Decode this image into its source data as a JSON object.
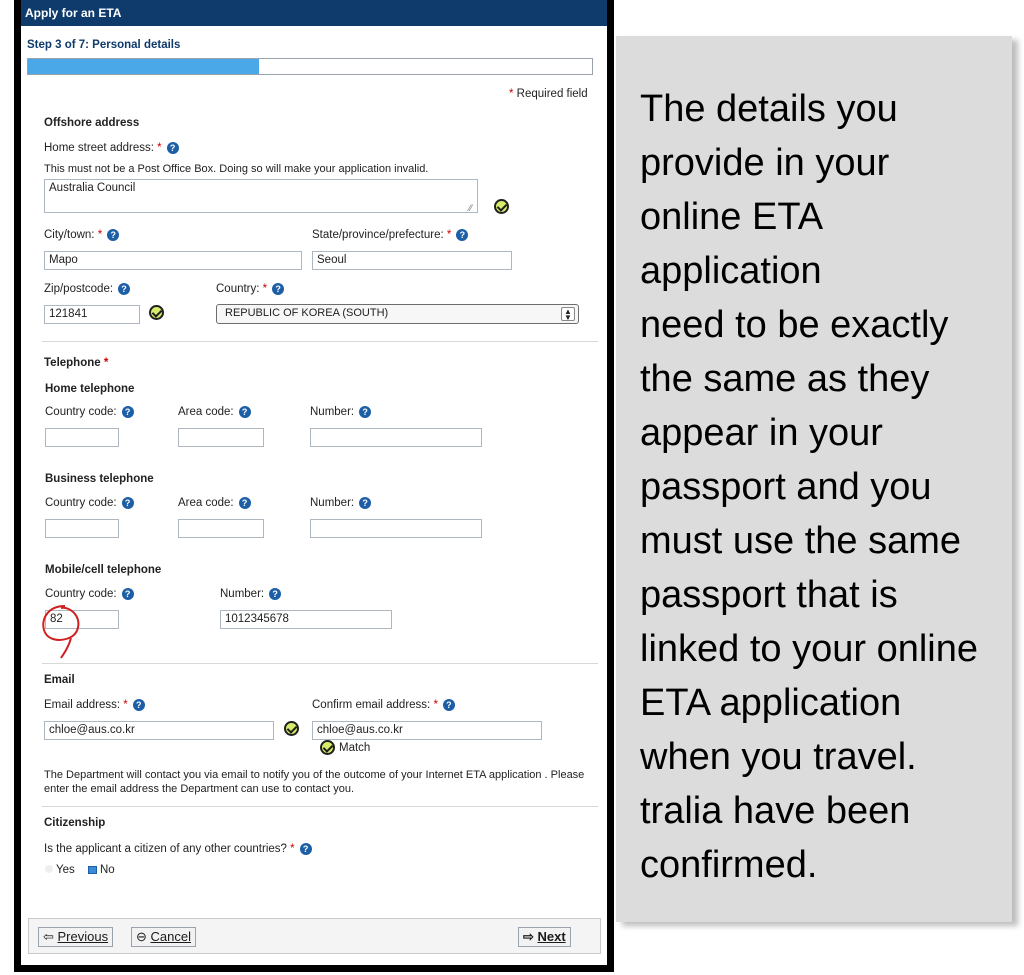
{
  "window": {
    "title": "Apply for an ETA"
  },
  "step": {
    "label": "Step 3 of 7: Personal details",
    "progress": 0.41
  },
  "required_note": "Required field",
  "offshore": {
    "heading": "Offshore address",
    "street_label": "Home street address:",
    "street_hint": "This must not be a Post Office Box. Doing so will make your application invalid.",
    "street_value": "Australia Council",
    "city_label": "City/town:",
    "city_value": "Mapo",
    "state_label": "State/province/prefecture:",
    "state_value": "Seoul",
    "zip_label": "Zip/postcode:",
    "zip_value": "121841",
    "country_label": "Country:",
    "country_value": "REPUBLIC OF KOREA (SOUTH)"
  },
  "telephone": {
    "heading": "Telephone",
    "home_heading": "Home telephone",
    "business_heading": "Business telephone",
    "mobile_heading": "Mobile/cell telephone",
    "country_code_label": "Country code:",
    "area_code_label": "Area code:",
    "number_label": "Number:",
    "mobile_country_code": "82",
    "mobile_number": "1012345678"
  },
  "email": {
    "heading": "Email",
    "address_label": "Email address:",
    "address_value": "chloe@aus.co.kr",
    "confirm_label": "Confirm email address:",
    "confirm_value": "chloe@aus.co.kr",
    "match_text": "Match",
    "notice": "The Department will contact you via email to notify you of the outcome of your Internet ETA application . Please enter the email address the Department can use to contact you."
  },
  "citizenship": {
    "heading": "Citizenship",
    "question": "Is the applicant a citizen of any other countries?",
    "yes_label": "Yes",
    "no_label": "No"
  },
  "buttons": {
    "previous": "Previous",
    "cancel": "Cancel",
    "next": "Next"
  },
  "annotation": {
    "text": "The details you\nprovide in your\nonline ETA\napplication\nneed to be exactly\nthe same as they\nappear in your\npassport and you\nmust use the same\npassport that is\nlinked to your online\nETA application\nwhen you travel.\ntralia have been\nconfirmed."
  },
  "colors": {
    "titlebar": "#0e3b6c",
    "progress": "#4aa8e8",
    "required": "#cc0000",
    "help": "#1d5fa6",
    "check": "#d7ec6a",
    "annotation_bg": "#dcdcdc",
    "circle_mark": "#d02020"
  }
}
